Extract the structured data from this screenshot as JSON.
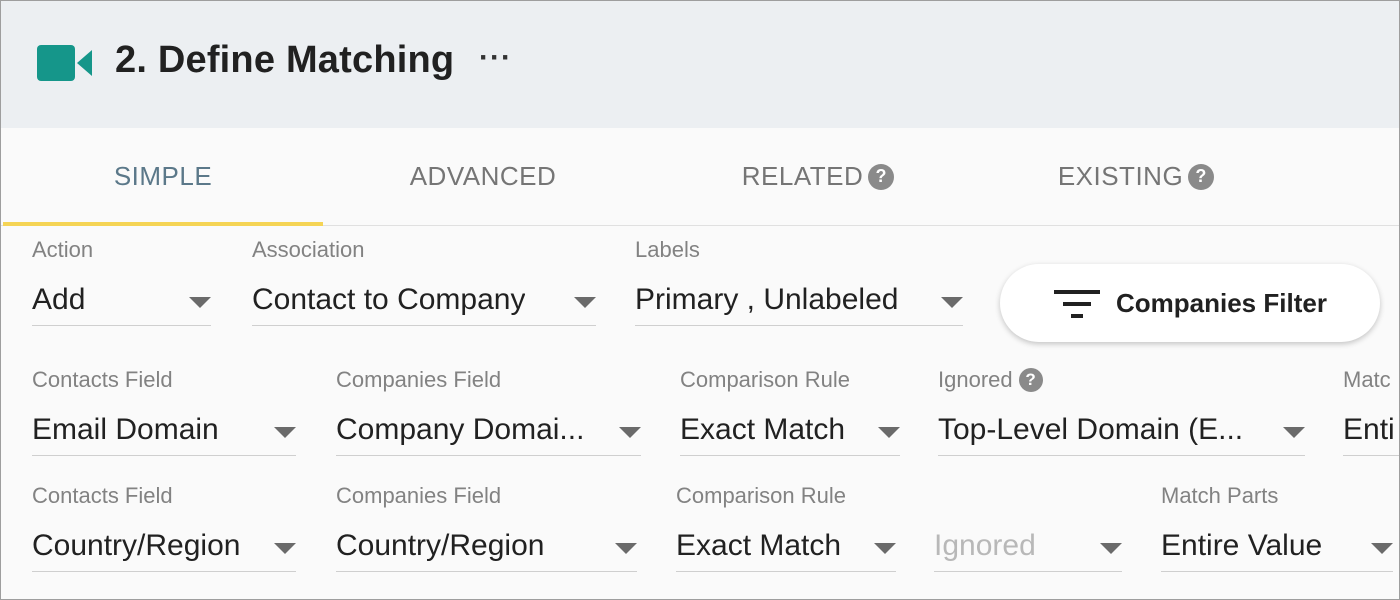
{
  "header": {
    "title": "2. Define Matching",
    "more_icon": "···",
    "icon": "video-camera-icon",
    "icon_color": "#15968a"
  },
  "tabs": [
    {
      "label": "SIMPLE",
      "active": true
    },
    {
      "label": "ADVANCED",
      "active": false
    },
    {
      "label": "RELATED",
      "active": false,
      "help": "?"
    },
    {
      "label": "EXISTING",
      "active": false,
      "help": "?"
    }
  ],
  "accent_colors": {
    "tab_active_underline": "#f5d455",
    "tab_active_text": "#5b7889"
  },
  "settings": {
    "action": {
      "label": "Action",
      "value": "Add"
    },
    "association": {
      "label": "Association",
      "value": "Contact to Company"
    },
    "labels": {
      "label": "Labels",
      "value": "Primary , Unlabeled"
    },
    "filter_button": {
      "label": "Companies Filter",
      "icon": "filter-icon"
    }
  },
  "rows": [
    {
      "contacts_field": {
        "label": "Contacts Field",
        "value": "Email Domain"
      },
      "companies_field": {
        "label": "Companies Field",
        "value": "Company Domai..."
      },
      "comparison_rule": {
        "label": "Comparison Rule",
        "value": "Exact Match"
      },
      "ignored": {
        "label": "Ignored",
        "help": "?",
        "value": "Top-Level Domain (E..."
      },
      "match_parts": {
        "label": "Matc",
        "value": "Enti"
      }
    },
    {
      "contacts_field": {
        "label": "Contacts Field",
        "value": "Country/Region"
      },
      "companies_field": {
        "label": "Companies Field",
        "value": "Country/Region"
      },
      "comparison_rule": {
        "label": "Comparison Rule",
        "value": "Exact Match"
      },
      "ignored": {
        "placeholder": "Ignored"
      },
      "match_parts": {
        "label": "Match Parts",
        "value": "Entire Value"
      }
    }
  ]
}
